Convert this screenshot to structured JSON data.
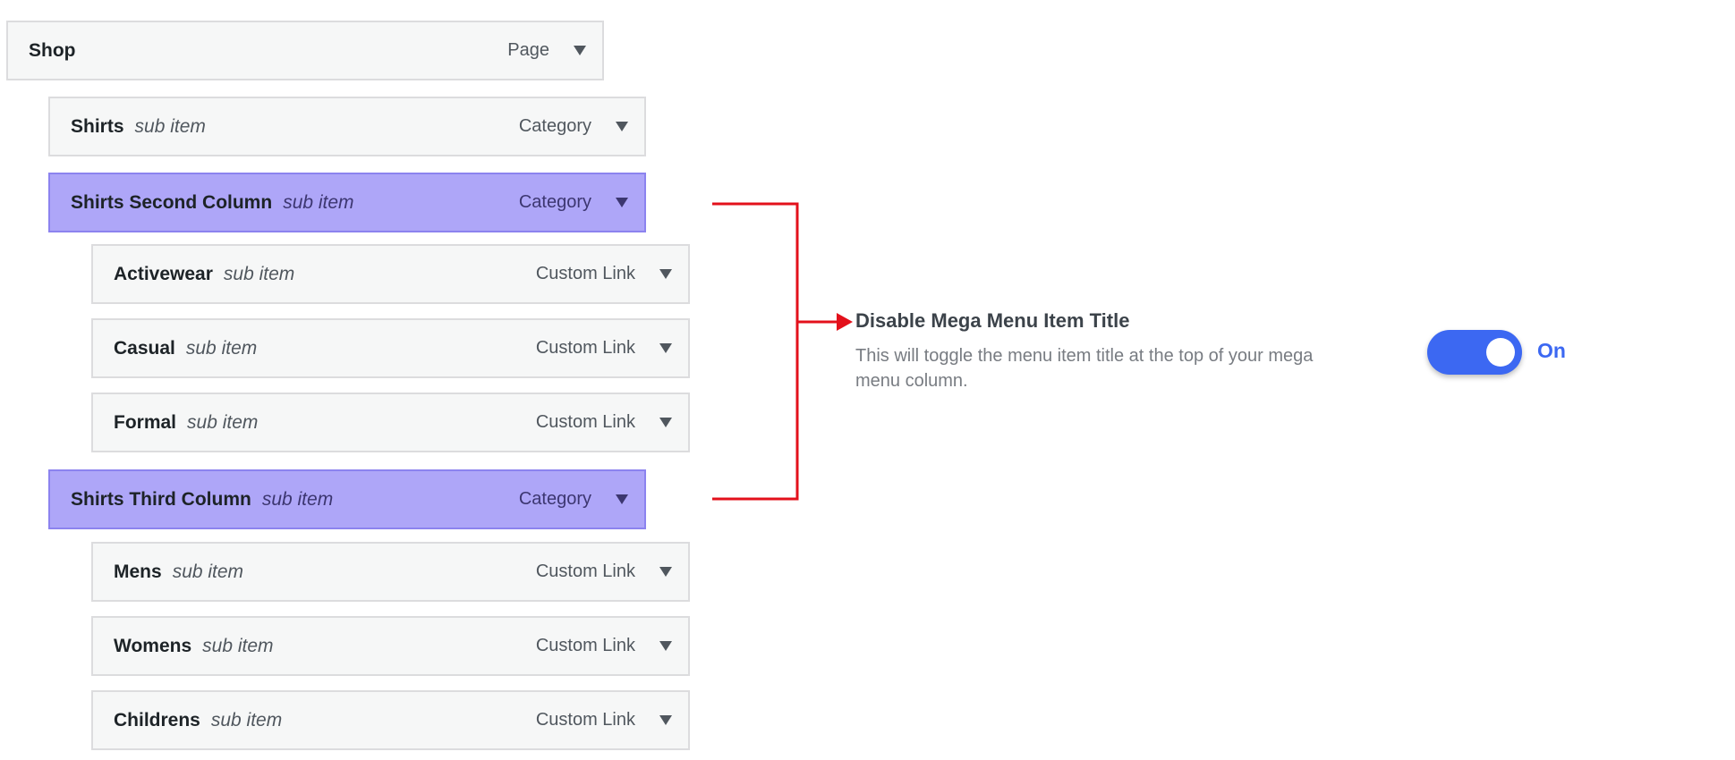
{
  "menu": {
    "items": [
      {
        "title": "Shop",
        "sub": "",
        "type": "Page"
      },
      {
        "title": "Shirts",
        "sub": "sub item",
        "type": "Category"
      },
      {
        "title": "Shirts Second Column",
        "sub": "sub item",
        "type": "Category"
      },
      {
        "title": "Activewear",
        "sub": "sub item",
        "type": "Custom Link"
      },
      {
        "title": "Casual",
        "sub": "sub item",
        "type": "Custom Link"
      },
      {
        "title": "Formal",
        "sub": "sub item",
        "type": "Custom Link"
      },
      {
        "title": "Shirts Third Column",
        "sub": "sub item",
        "type": "Category"
      },
      {
        "title": "Mens",
        "sub": "sub item",
        "type": "Custom Link"
      },
      {
        "title": "Womens",
        "sub": "sub item",
        "type": "Custom Link"
      },
      {
        "title": "Childrens",
        "sub": "sub item",
        "type": "Custom Link"
      }
    ]
  },
  "setting": {
    "title": "Disable Mega Menu Item Title",
    "description": "This will toggle the menu item title at the top of your mega menu column.",
    "toggle_state": "On"
  },
  "colors": {
    "highlight": "#aea6f8",
    "connector": "#e3101b",
    "toggle": "#3c68f2"
  },
  "icons": {
    "expand": "triangle-down-icon",
    "connector": "bracket-arrow-icon"
  }
}
